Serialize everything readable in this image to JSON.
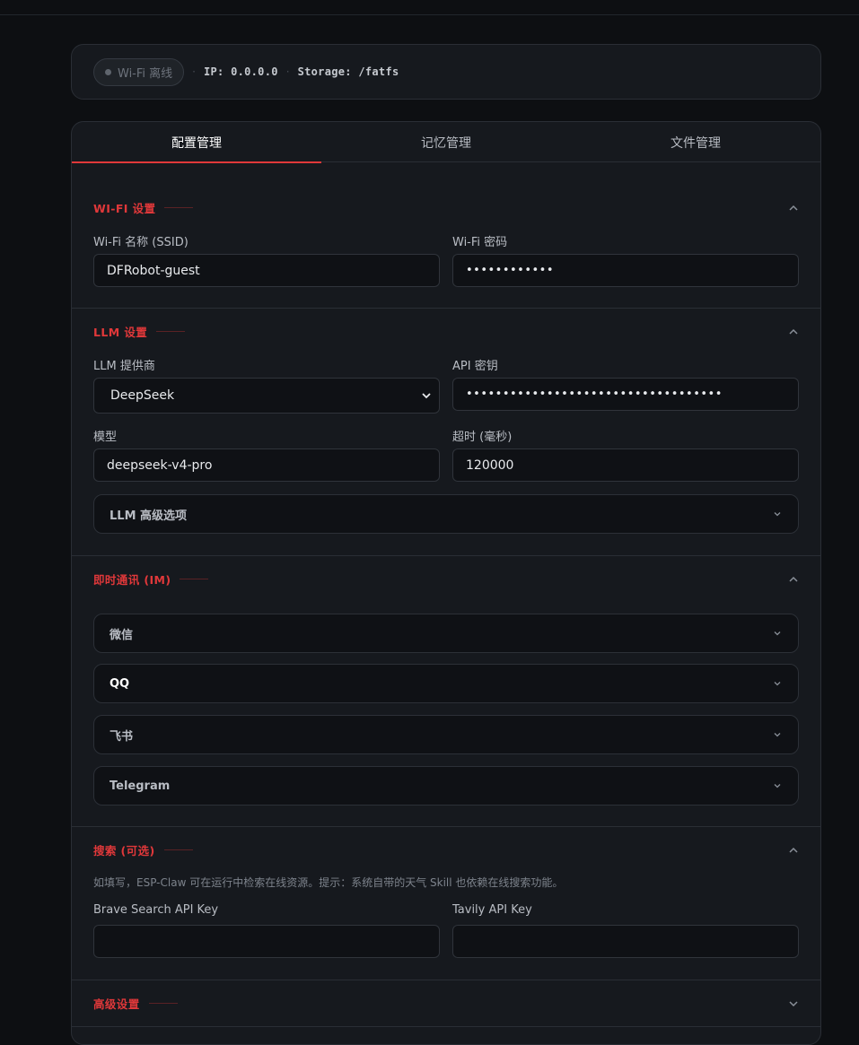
{
  "status": {
    "wifi_label": "Wi-Fi 离线",
    "separator": "·",
    "ip": "IP: 0.0.0.0",
    "storage": "Storage: /fatfs"
  },
  "tabs": [
    {
      "label": "配置管理",
      "active": true
    },
    {
      "label": "记忆管理",
      "active": false
    },
    {
      "label": "文件管理",
      "active": false
    }
  ],
  "wifi": {
    "title": "WI-FI 设置",
    "ssid_label": "Wi-Fi 名称 (SSID)",
    "ssid_value": "DFRobot-guest",
    "password_label": "Wi-Fi 密码",
    "password_value": "••••••••••••"
  },
  "llm": {
    "title": "LLM 设置",
    "provider_label": "LLM 提供商",
    "provider_value": "DeepSeek",
    "apikey_label": "API 密钥",
    "apikey_value": "•••••••••••••••••••••••••••••••••••",
    "model_label": "模型",
    "model_value": "deepseek-v4-pro",
    "timeout_label": "超时 (毫秒)",
    "timeout_value": "120000",
    "advanced_label": "LLM 高级选项"
  },
  "im": {
    "title": "即时通讯 (IM)",
    "items": [
      "微信",
      "QQ",
      "飞书",
      "Telegram"
    ]
  },
  "search": {
    "title": "搜索 (可选)",
    "hint": "如填写，ESP-Claw 可在运行中检索在线资源。提示：系统自带的天气 Skill 也依赖在线搜索功能。",
    "brave_label": "Brave Search API Key",
    "brave_value": "",
    "tavily_label": "Tavily API Key",
    "tavily_value": ""
  },
  "advanced": {
    "title": "高级设置"
  },
  "colors": {
    "accent": "#e0383a",
    "background": "#0d0f12",
    "card": "#16191e",
    "input": "#0f1115"
  }
}
